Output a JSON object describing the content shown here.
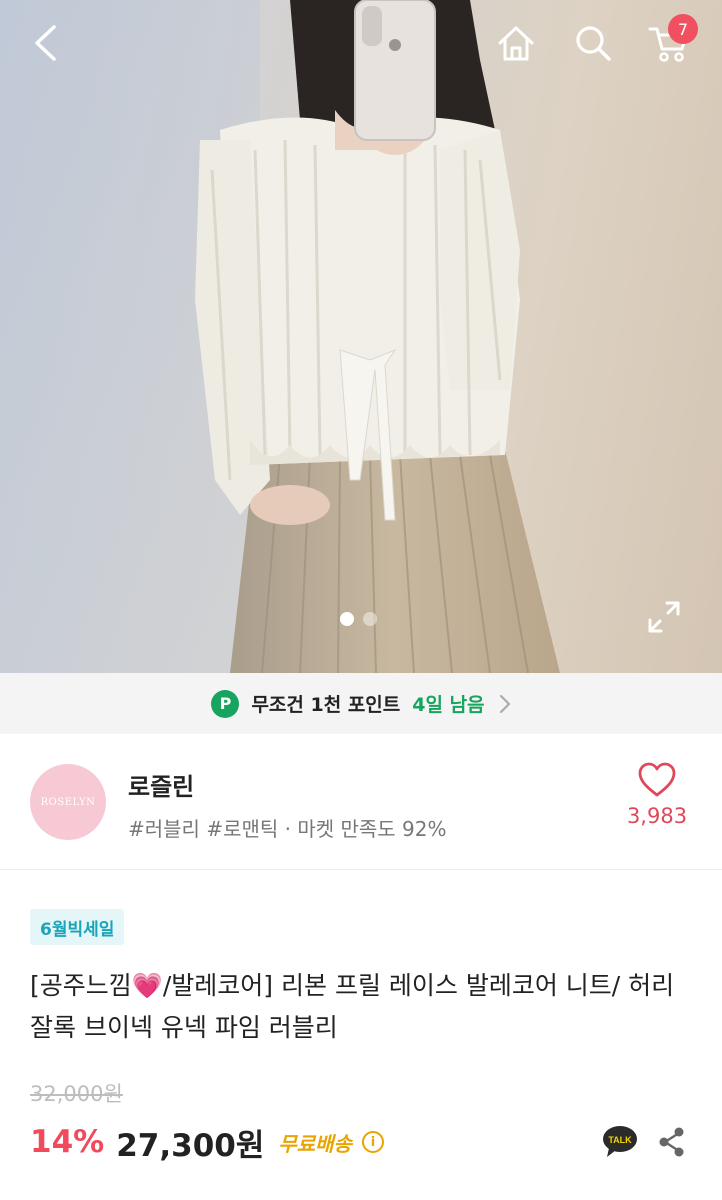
{
  "header": {
    "back_icon": "back-arrow-icon",
    "home_icon": "home-icon",
    "search_icon": "search-icon",
    "cart_icon": "cart-icon",
    "cart_count": "7"
  },
  "gallery": {
    "total_images": 2,
    "current_index": 1,
    "expand_icon": "expand-icon"
  },
  "point_banner": {
    "badge": "P",
    "text": "무조건 1천 포인트",
    "days_left": "4일 남음"
  },
  "store": {
    "logo_text": "ROSELYN",
    "name": "로즐린",
    "tags": "#러블리 #로맨틱 · 마켓 만족도 92%",
    "like_count": "3,983"
  },
  "product": {
    "sale_badge": "6월빅세일",
    "title": "[공주느낌💗/발레코어] 리본 프릴 레이스 발레코어 니트/ 허리잘록 브이넥 유넥 파임 러블리",
    "original_price": "32,000원",
    "discount": "14%",
    "price": "27,300원",
    "shipping": "무료배송"
  },
  "colors": {
    "accent_pink": "#f04a5c",
    "point_green": "#16a45e",
    "sale_teal": "#1aa4b8",
    "shipping_gold": "#e9a400"
  }
}
